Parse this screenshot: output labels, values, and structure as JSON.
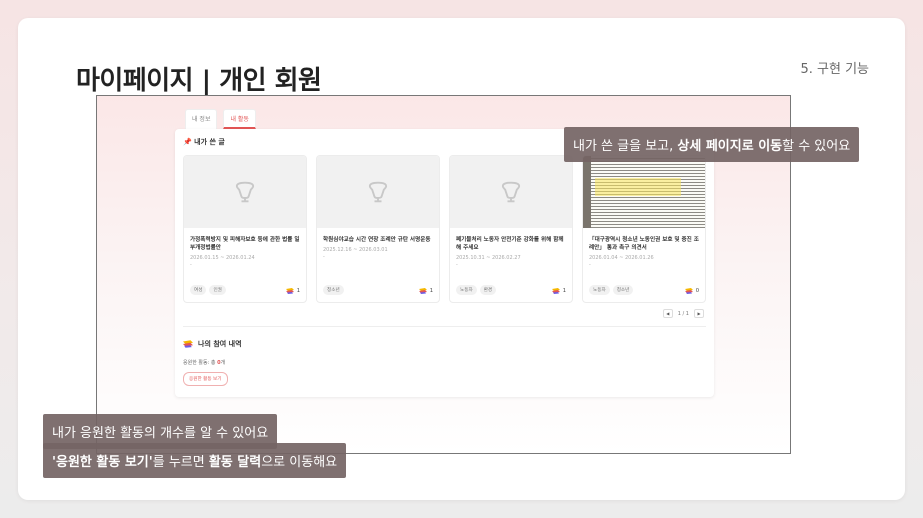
{
  "slide": {
    "title": "마이페이지 | 개인 회원",
    "section_label": "5. 구현 기능"
  },
  "tabs": [
    {
      "label": "내 정보"
    },
    {
      "label": "내 활동"
    }
  ],
  "my_posts": {
    "heading": "📌 내가 쓴 글",
    "cards": [
      {
        "title": "가정폭력방지 및 피해자보호 등에 관한 법률 일부개정법률안",
        "date": "2026.01.15 ~ 2026.01.24",
        "dash": "-",
        "tags": [
          "여성",
          "인권"
        ],
        "count": "1",
        "image": "placeholder"
      },
      {
        "title": "학원심야교습 시간 연장 조례안 규탄 서명운동",
        "date": "2025.12.16 ~ 2026.03.01",
        "dash": "-",
        "tags": [
          "청소년"
        ],
        "count": "1",
        "image": "placeholder"
      },
      {
        "title": "폐기물처리 노동자 안전기준 강화를 위해 함께해 주세요",
        "date": "2025.10.31 ~ 2026.02.27",
        "dash": "-",
        "tags": [
          "노동자",
          "환경"
        ],
        "count": "1",
        "image": "placeholder"
      },
      {
        "title": "「대구광역시 청소년 노동인권 보호 및 증진 조례안」 통과 촉구 의견서",
        "date": "2026.01.04 ~ 2026.01.26",
        "dash": "-",
        "tags": [
          "노동자",
          "청소년"
        ],
        "count": "0",
        "image": "document"
      }
    ],
    "pager": {
      "prev": "◀",
      "text": "1 / 1",
      "next": "▶"
    }
  },
  "participation": {
    "heading": "나의 참여 내역",
    "support_count_label": "응원한 활동: 총 ",
    "support_count_value": "0",
    "support_count_unit": "개",
    "support_button": "응원한 활동 보기"
  },
  "callouts": {
    "top": {
      "prefix": "내가 쓴 글을 보고, ",
      "bold": "상세 페이지로 이동",
      "suffix": "할 수 있어요"
    },
    "bottom_1": {
      "text": "내가 응원한 활동의 개수를 알 수 있어요"
    },
    "bottom_2": {
      "bold1": "'응원한 활동 보기'",
      "mid": "를 누르면 ",
      "bold2": "활동 달력",
      "suffix": "으로 이동해요"
    }
  },
  "colors": {
    "accent": "#e25555",
    "callout_bg": "#746464"
  },
  "icons": {
    "placeholder": "image-placeholder-icon",
    "support": "support-ribbon-icon",
    "pin": "pin-icon"
  }
}
